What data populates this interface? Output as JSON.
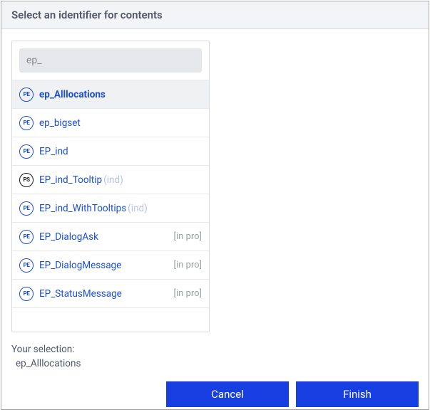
{
  "title": "Select an identifier for contents",
  "search": {
    "value": "ep_"
  },
  "icons": {
    "pe": "PE",
    "ps": "PS"
  },
  "items": [
    {
      "icon": "pe",
      "label": "ep_Alllocations",
      "suffix": "",
      "badge": "",
      "selected": true
    },
    {
      "icon": "pe",
      "label": "ep_bigset",
      "suffix": "",
      "badge": "",
      "selected": false
    },
    {
      "icon": "pe",
      "label": "EP_ind",
      "suffix": "",
      "badge": "",
      "selected": false
    },
    {
      "icon": "ps",
      "label": "EP_ind_Tooltip",
      "suffix": "(ind)",
      "badge": "",
      "selected": false
    },
    {
      "icon": "pe",
      "label": "EP_ind_WithTooltips",
      "suffix": "(ind)",
      "badge": "",
      "selected": false
    },
    {
      "icon": "pe",
      "label": "EP_DialogAsk",
      "suffix": "",
      "badge": "[in pro]",
      "selected": false
    },
    {
      "icon": "pe",
      "label": "EP_DialogMessage",
      "suffix": "",
      "badge": "[in pro]",
      "selected": false
    },
    {
      "icon": "pe",
      "label": "EP_StatusMessage",
      "suffix": "",
      "badge": "[in pro]",
      "selected": false
    }
  ],
  "selection": {
    "label": "Your selection:",
    "value": "ep_Alllocations"
  },
  "buttons": {
    "cancel": "Cancel",
    "finish": "Finish"
  }
}
